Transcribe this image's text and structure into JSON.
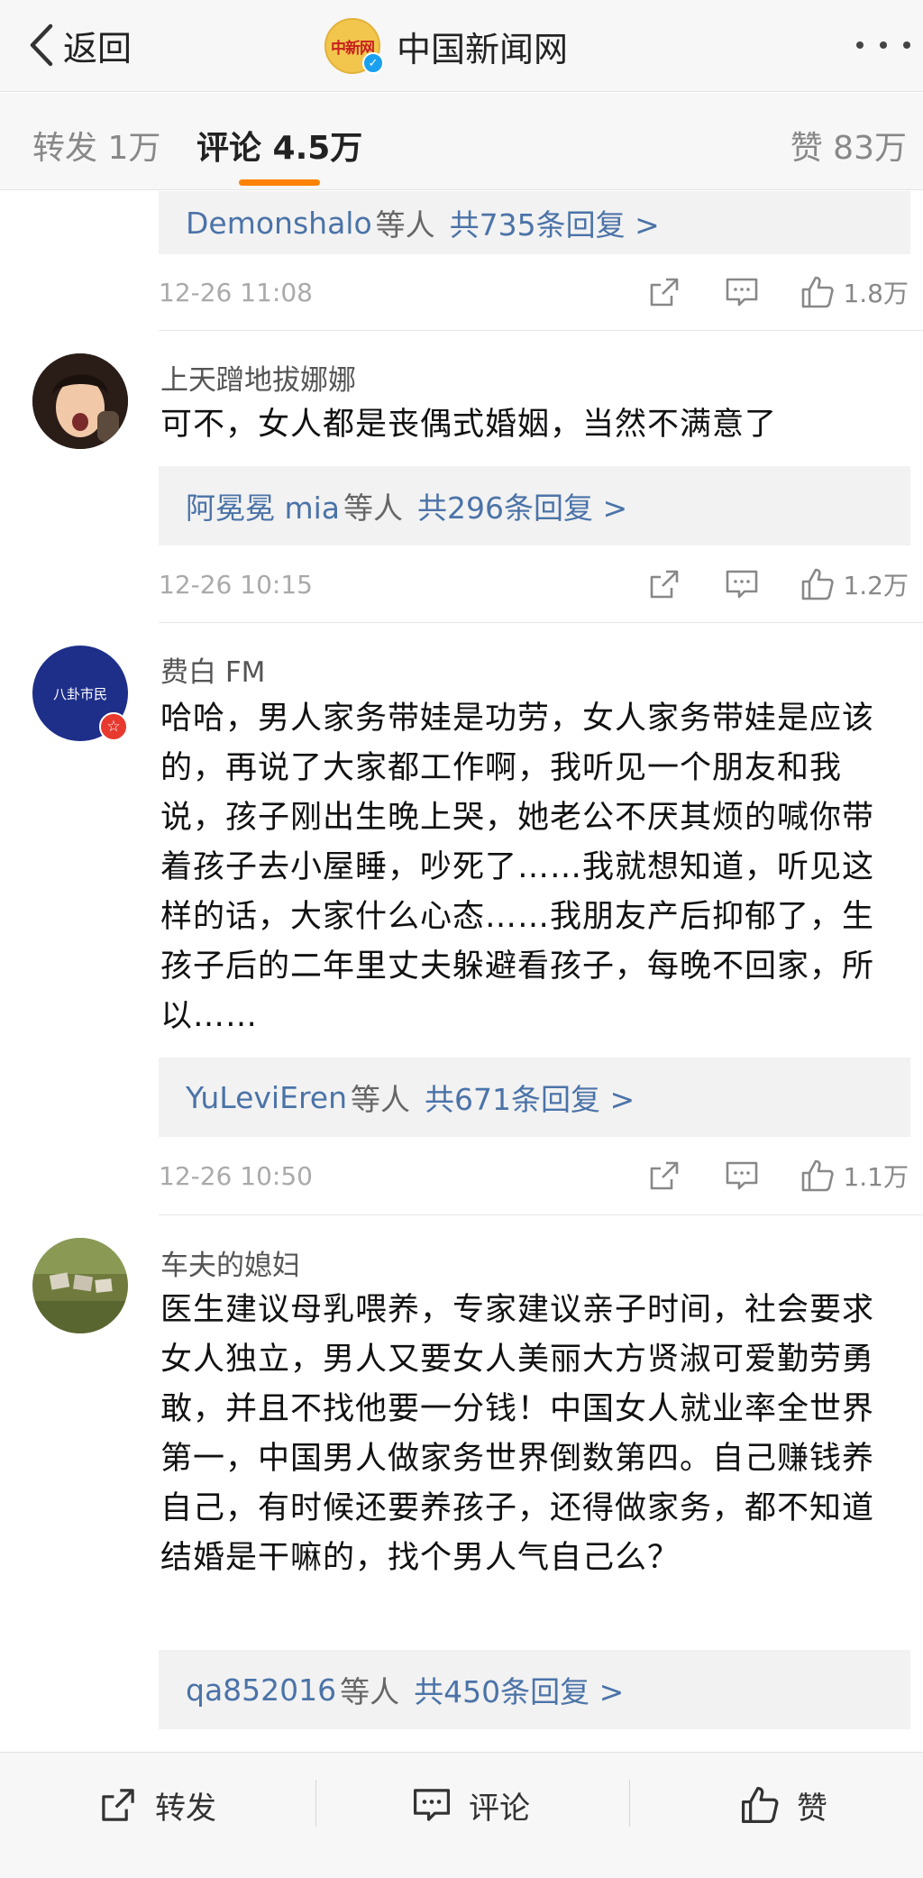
{
  "nav": {
    "back_label": "返回",
    "logo_text": "中新网",
    "title": "中国新闻网"
  },
  "tabs": {
    "repost": "转发 1万",
    "comments": "评论 4.5万",
    "likes": "赞 83万",
    "accent": "#ff8200"
  },
  "comments": [
    {
      "reply_names": "Demonshalo",
      "reply_mid": "等人",
      "reply_count": "共735条回复 >",
      "time": "12-26 11:08",
      "likes": "1.8万"
    },
    {
      "name": "上天蹭地拔娜娜",
      "text": "可不，女人都是丧偶式婚姻，当然不满意了",
      "reply_names": "阿冕冕 mia",
      "reply_mid": "等人",
      "reply_count": "共296条回复 >",
      "time": "12-26 10:15",
      "likes": "1.2万"
    },
    {
      "name": "费白 FM",
      "avatar_text": "八卦市民",
      "text": "哈哈，男人家务带娃是功劳，女人家务带娃是应该的，再说了大家都工作啊，我听见一个朋友和我说，孩子刚出生晚上哭，她老公不厌其烦的喊你带着孩子去小屋睡，吵死了……我就想知道，听见这样的话，大家什么心态……我朋友产后抑郁了，生孩子后的二年里丈夫躲避看孩子，每晚不回家，所以……",
      "reply_names": "YuLeviEren",
      "reply_mid": "等人",
      "reply_count": "共671条回复 >",
      "time": "12-26 10:50",
      "likes": "1.1万"
    },
    {
      "name": "车夫的媳妇",
      "text": "医生建议母乳喂养，专家建议亲子时间，社会要求女人独立，男人又要女人美丽大方贤淑可爱勤劳勇敢，并且不找他要一分钱！中国女人就业率全世界第一，中国男人做家务世界倒数第四。自己赚钱养自己，有时候还要养孩子，还得做家务，都不知道结婚是干嘛的，找个男人气自己么？",
      "reply_names": "qa852016",
      "reply_mid": "等人",
      "reply_count": "共450条回复 >"
    }
  ],
  "bottom_bar": {
    "repost": "转发",
    "comment": "评论",
    "like": "赞"
  },
  "icons": [
    "back-chevron-icon",
    "verified-icon",
    "more-icon",
    "share-icon",
    "comment-icon",
    "like-icon"
  ]
}
